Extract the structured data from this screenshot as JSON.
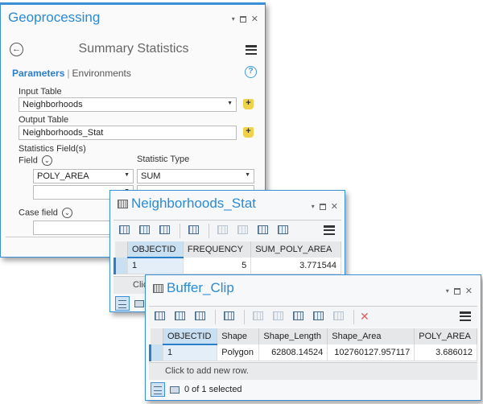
{
  "geoprocessing": {
    "title": "Geoprocessing",
    "tool_title": "Summary Statistics",
    "tabs": {
      "parameters": "Parameters",
      "separator": "|",
      "environments": "Environments"
    },
    "help": "?",
    "input_table": {
      "label": "Input Table",
      "value": "Neighborhoods"
    },
    "output_table": {
      "label": "Output Table",
      "value": "Neighborhoods_Stat"
    },
    "statistics_fields": {
      "label": "Statistics Field(s)",
      "field_label": "Field",
      "type_label": "Statistic Type",
      "rows": [
        {
          "field": "POLY_AREA",
          "type": "SUM"
        },
        {
          "field": "",
          "type": ""
        }
      ]
    },
    "case_field": {
      "label": "Case field",
      "value": ""
    }
  },
  "neighborhoods_stat": {
    "title": "Neighborhoods_Stat",
    "columns": [
      "OBJECTID",
      "FREQUENCY",
      "SUM_POLY_AREA"
    ],
    "rows": [
      [
        "1",
        "5",
        "3.771544"
      ]
    ],
    "add_row": "Clic"
  },
  "buffer_clip": {
    "title": "Buffer_Clip",
    "columns": [
      "OBJECTID",
      "Shape",
      "Shape_Length",
      "Shape_Area",
      "POLY_AREA"
    ],
    "rows": [
      [
        "1",
        "Polygon",
        "62808.14524",
        "102760127.957117",
        "3.686012"
      ]
    ],
    "add_row": "Click to add new row.",
    "status": "0 of 1 selected"
  },
  "glyphs": {
    "pin": "▾",
    "close": "✕",
    "back": "←",
    "chev": "⌄",
    "dd": "▼",
    "add": "+",
    "delete": "✕"
  }
}
